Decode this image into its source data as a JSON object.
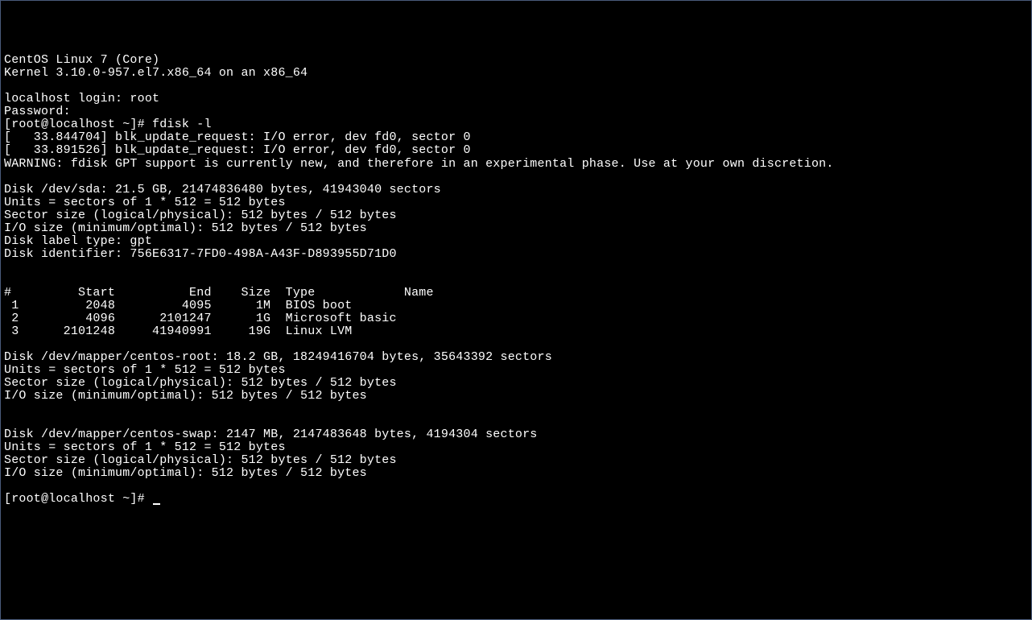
{
  "terminal": {
    "lines": [
      "CentOS Linux 7 (Core)",
      "Kernel 3.10.0-957.el7.x86_64 on an x86_64",
      "",
      "localhost login: root",
      "Password:",
      "[root@localhost ~]# fdisk -l",
      "[   33.844704] blk_update_request: I/O error, dev fd0, sector 0",
      "[   33.891526] blk_update_request: I/O error, dev fd0, sector 0",
      "WARNING: fdisk GPT support is currently new, and therefore in an experimental phase. Use at your own discretion.",
      "",
      "Disk /dev/sda: 21.5 GB, 21474836480 bytes, 41943040 sectors",
      "Units = sectors of 1 * 512 = 512 bytes",
      "Sector size (logical/physical): 512 bytes / 512 bytes",
      "I/O size (minimum/optimal): 512 bytes / 512 bytes",
      "Disk label type: gpt",
      "Disk identifier: 756E6317-7FD0-498A-A43F-D893955D71D0",
      "",
      "",
      "#         Start          End    Size  Type            Name",
      " 1         2048         4095      1M  BIOS boot",
      " 2         4096      2101247      1G  Microsoft basic",
      " 3      2101248     41940991     19G  Linux LVM",
      "",
      "Disk /dev/mapper/centos-root: 18.2 GB, 18249416704 bytes, 35643392 sectors",
      "Units = sectors of 1 * 512 = 512 bytes",
      "Sector size (logical/physical): 512 bytes / 512 bytes",
      "I/O size (minimum/optimal): 512 bytes / 512 bytes",
      "",
      "",
      "Disk /dev/mapper/centos-swap: 2147 MB, 2147483648 bytes, 4194304 sectors",
      "Units = sectors of 1 * 512 = 512 bytes",
      "Sector size (logical/physical): 512 bytes / 512 bytes",
      "I/O size (minimum/optimal): 512 bytes / 512 bytes",
      ""
    ],
    "prompt": "[root@localhost ~]# "
  }
}
